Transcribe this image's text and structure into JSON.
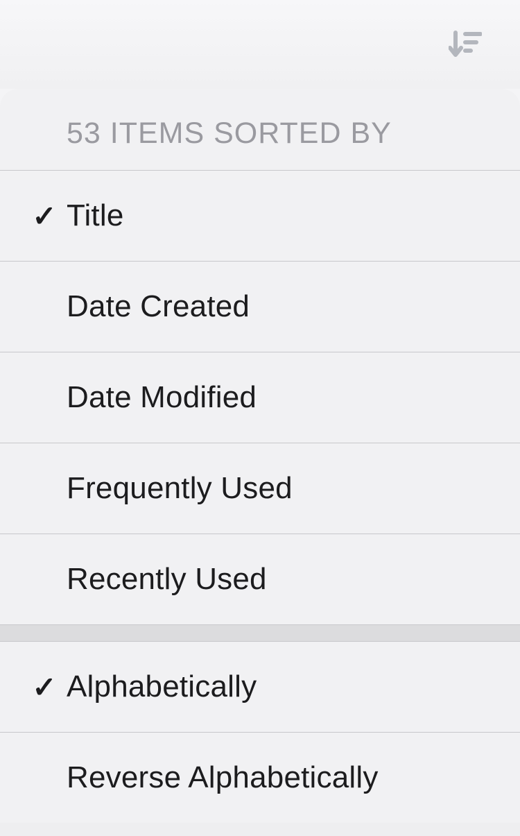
{
  "toolbar": {
    "sort_icon": "sort-descending-icon"
  },
  "header": "53 ITEMS SORTED BY",
  "sortOptions": [
    {
      "label": "Title",
      "checked": true
    },
    {
      "label": "Date Created",
      "checked": false
    },
    {
      "label": "Date Modified",
      "checked": false
    },
    {
      "label": "Frequently Used",
      "checked": false
    },
    {
      "label": "Recently Used",
      "checked": false
    }
  ],
  "orderOptions": [
    {
      "label": "Alphabetically",
      "checked": true
    },
    {
      "label": "Reverse Alphabetically",
      "checked": false
    }
  ],
  "checkGlyph": "✓"
}
